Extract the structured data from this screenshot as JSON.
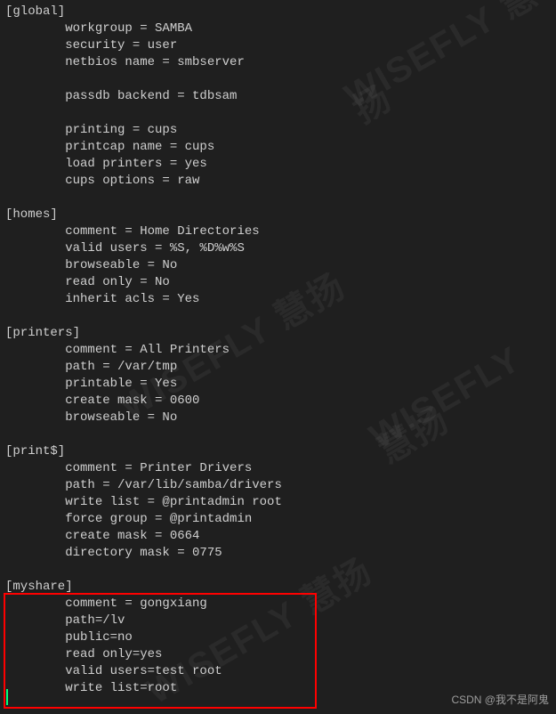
{
  "watermark_text": "WISEFLY 慧扬",
  "attribution": "CSDN @我不是阿鬼",
  "config": {
    "sections": [
      {
        "header": "[global]",
        "indent": "        ",
        "lines": [
          "workgroup = SAMBA",
          "security = user",
          "netbios name = smbserver",
          "",
          "passdb backend = tdbsam",
          "",
          "printing = cups",
          "printcap name = cups",
          "load printers = yes",
          "cups options = raw"
        ]
      },
      {
        "header": "[homes]",
        "indent": "        ",
        "lines": [
          "comment = Home Directories",
          "valid users = %S, %D%w%S",
          "browseable = No",
          "read only = No",
          "inherit acls = Yes"
        ]
      },
      {
        "header": "[printers]",
        "indent": "        ",
        "lines": [
          "comment = All Printers",
          "path = /var/tmp",
          "printable = Yes",
          "create mask = 0600",
          "browseable = No"
        ]
      },
      {
        "header": "[print$]",
        "indent": "        ",
        "lines": [
          "comment = Printer Drivers",
          "path = /var/lib/samba/drivers",
          "write list = @printadmin root",
          "force group = @printadmin",
          "create mask = 0664",
          "directory mask = 0775"
        ]
      },
      {
        "header": "[myshare]",
        "indent": "        ",
        "highlighted": true,
        "lines": [
          "comment = gongxiang",
          "path=/lv",
          "public=no",
          "read only=yes",
          "valid users=test root",
          "write list=root"
        ]
      }
    ]
  }
}
